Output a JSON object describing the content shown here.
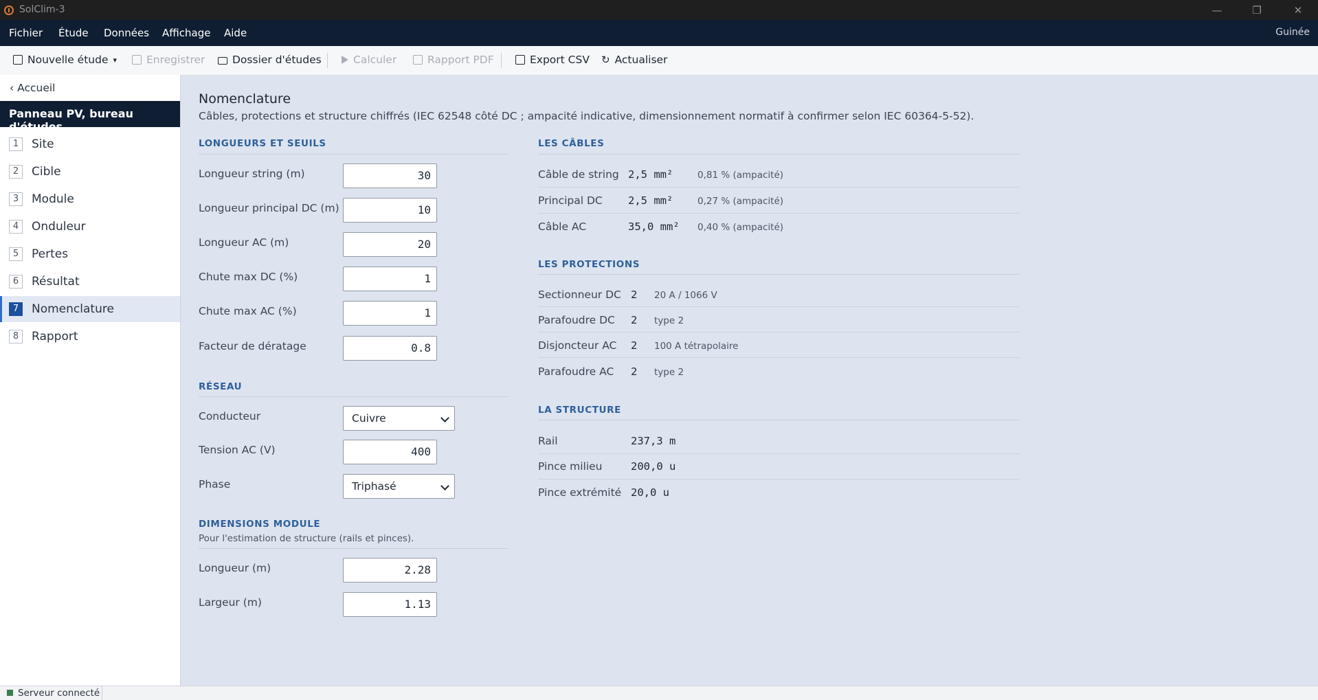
{
  "app": {
    "title": "SolClim-3",
    "region": "Guinée"
  },
  "menu": [
    "Fichier",
    "Étude",
    "Données",
    "Affichage",
    "Aide"
  ],
  "toolbar": {
    "new_study": "Nouvelle étude",
    "save": "Enregistrer",
    "folder": "Dossier d'études",
    "compute": "Calculer",
    "pdf": "Rapport PDF",
    "csv": "Export CSV",
    "refresh": "Actualiser"
  },
  "sidebar": {
    "back": "Accueil",
    "study": "Panneau PV, bureau d'études",
    "steps": [
      {
        "num": "1",
        "label": "Site"
      },
      {
        "num": "2",
        "label": "Cible"
      },
      {
        "num": "3",
        "label": "Module"
      },
      {
        "num": "4",
        "label": "Onduleur"
      },
      {
        "num": "5",
        "label": "Pertes"
      },
      {
        "num": "6",
        "label": "Résultat"
      },
      {
        "num": "7",
        "label": "Nomenclature"
      },
      {
        "num": "8",
        "label": "Rapport"
      }
    ]
  },
  "page": {
    "title": "Nomenclature",
    "subtitle": "Câbles, protections et structure chiffrés (IEC 62548 côté DC ; ampacité indicative, dimensionnement normatif à confirmer selon IEC 60364-5-52)."
  },
  "lengths": {
    "heading": "LONGUEURS ET SEUILS",
    "fields": [
      {
        "label": "Longueur string (m)",
        "value": "30"
      },
      {
        "label": "Longueur principal DC (m)",
        "value": "10"
      },
      {
        "label": "Longueur AC (m)",
        "value": "20"
      },
      {
        "label": "Chute max DC (%)",
        "value": "1"
      },
      {
        "label": "Chute max AC (%)",
        "value": "1"
      },
      {
        "label": "Facteur de dératage",
        "value": "0.8"
      }
    ]
  },
  "network": {
    "heading": "RÉSEAU",
    "conductor_label": "Conducteur",
    "conductor_value": "Cuivre",
    "voltage_label": "Tension AC (V)",
    "voltage_value": "400",
    "phase_label": "Phase",
    "phase_value": "Triphasé"
  },
  "module_dims": {
    "heading": "DIMENSIONS MODULE",
    "note": "Pour l'estimation de structure (rails et pinces).",
    "length_label": "Longueur (m)",
    "length_value": "2.28",
    "width_label": "Largeur (m)",
    "width_value": "1.13"
  },
  "cables": {
    "heading": "LES CÂBLES",
    "rows": [
      {
        "label": "Câble de string",
        "value": "2,5 mm²",
        "note": "0,81 % (ampacité)"
      },
      {
        "label": "Principal DC",
        "value": "2,5 mm²",
        "note": "0,27 % (ampacité)"
      },
      {
        "label": "Câble AC",
        "value": "35,0 mm²",
        "note": "0,40 % (ampacité)"
      }
    ]
  },
  "protections": {
    "heading": "LES PROTECTIONS",
    "rows": [
      {
        "label": "Sectionneur DC",
        "value": "2",
        "note": "20 A / 1066 V"
      },
      {
        "label": "Parafoudre DC",
        "value": "2",
        "note": "type 2"
      },
      {
        "label": "Disjoncteur AC",
        "value": "2",
        "note": "100 A tétrapolaire"
      },
      {
        "label": "Parafoudre AC",
        "value": "2",
        "note": "type 2"
      }
    ]
  },
  "structure": {
    "heading": "LA STRUCTURE",
    "rows": [
      {
        "label": "Rail",
        "value": "237,3 m"
      },
      {
        "label": "Pince milieu",
        "value": "200,0 u"
      },
      {
        "label": "Pince extrémité",
        "value": "20,0 u"
      }
    ]
  },
  "status": {
    "text": "Serveur connecté"
  }
}
